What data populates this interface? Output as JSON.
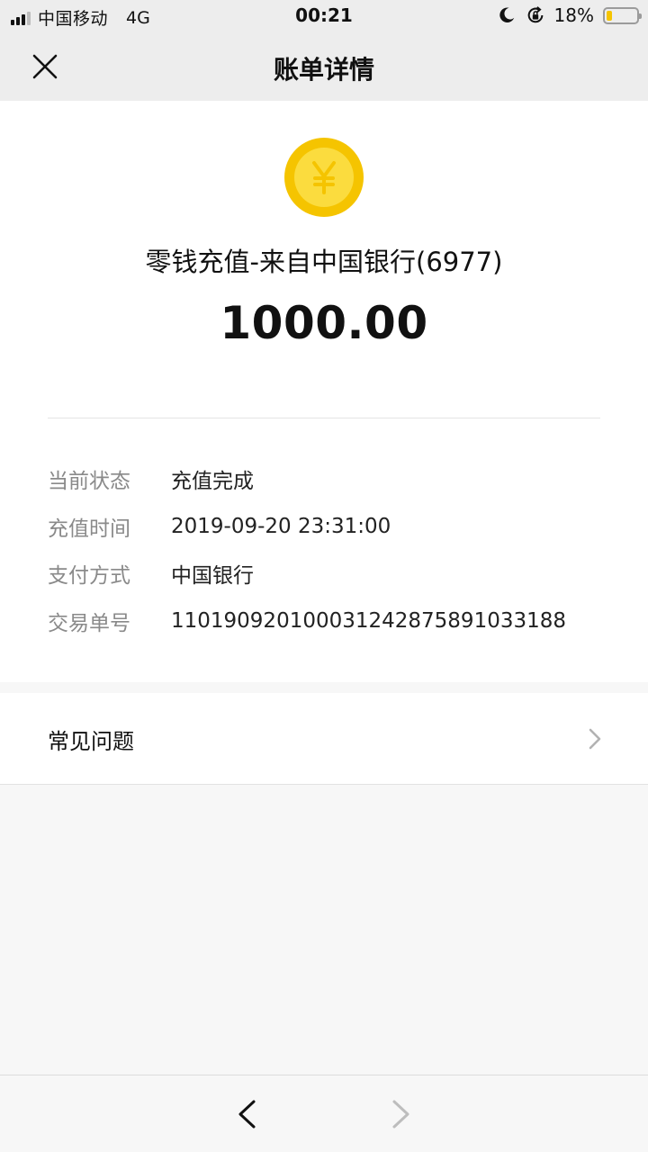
{
  "status_bar": {
    "carrier": "中国移动",
    "network": "4G",
    "time": "00:21",
    "battery_percent": "18%",
    "battery_level": 0.18,
    "signal_bars": 3,
    "icons": [
      "signal-icon",
      "moon-icon",
      "rotation-lock-icon",
      "battery-icon"
    ]
  },
  "nav": {
    "title": "账单详情",
    "close_icon": "close-icon"
  },
  "bill": {
    "icon": "yuan-coin-icon",
    "title": "零钱充值-来自中国银行(6977)",
    "amount": "1000.00",
    "details": [
      {
        "label": "当前状态",
        "value": "充值完成"
      },
      {
        "label": "充值时间",
        "value": "2019-09-20 23:31:00"
      },
      {
        "label": "支付方式",
        "value": "中国银行"
      },
      {
        "label": "交易单号",
        "value": "110190920100031242875891033188"
      }
    ]
  },
  "faq": {
    "label": "常见问题",
    "icon": "chevron-right-icon"
  },
  "toolbar": {
    "back_icon": "back-arrow-icon",
    "forward_icon": "forward-arrow-icon"
  },
  "colors": {
    "coin": "#f5c400",
    "coin_inner": "#fbdc3e",
    "header_bg": "#ededed",
    "page_bg": "#f7f7f7"
  }
}
